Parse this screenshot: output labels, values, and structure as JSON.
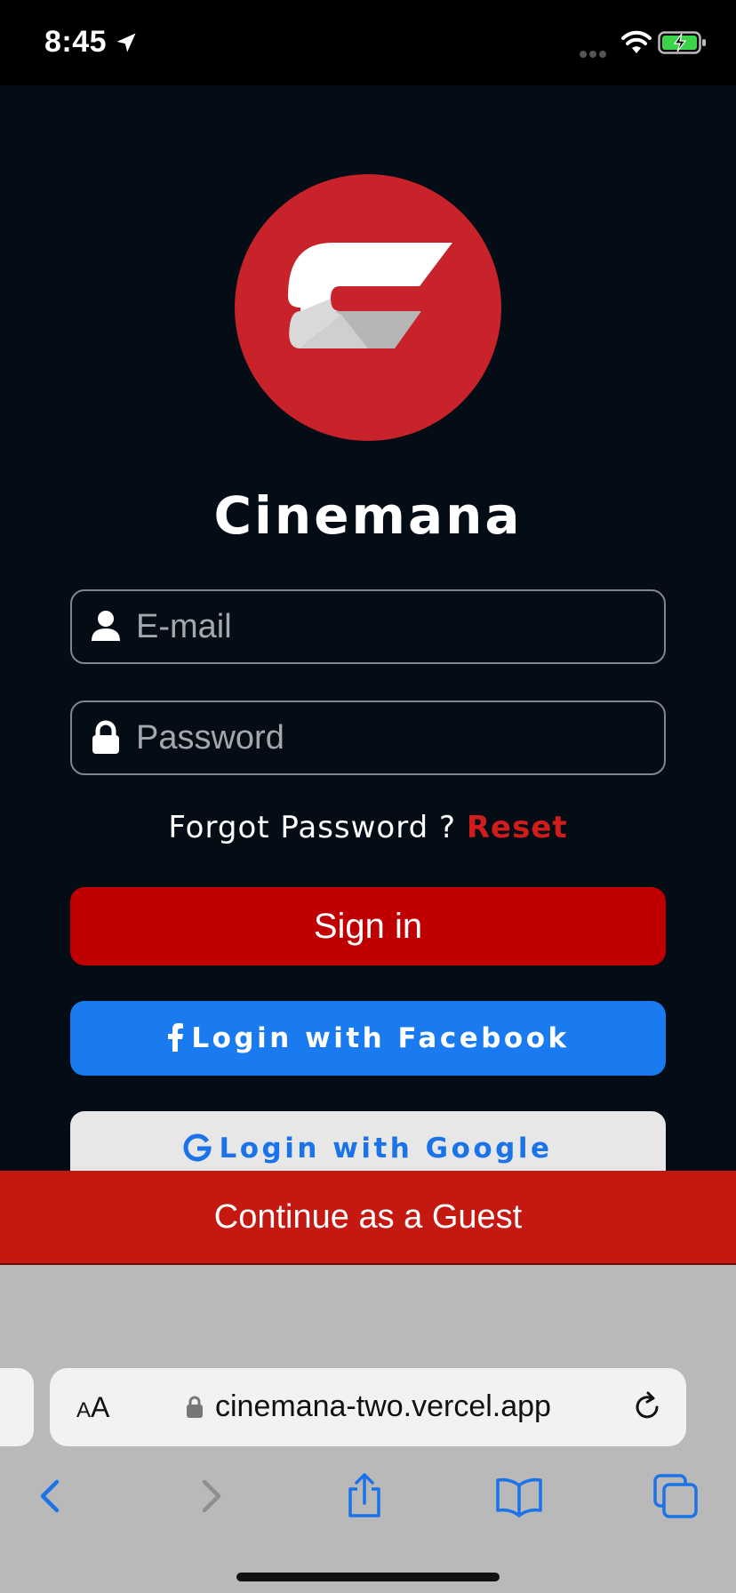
{
  "status_bar": {
    "time": "8:45",
    "icons": [
      "location-arrow-icon",
      "cellular-dots-icon",
      "wifi-icon",
      "battery-charging-icon"
    ]
  },
  "app": {
    "brand_name": "Cinemana",
    "logo_icon": "cinemana-c-logo",
    "email": {
      "placeholder": "E-mail",
      "value": "",
      "icon": "user-icon"
    },
    "password": {
      "placeholder": "Password",
      "value": "",
      "icon": "lock-icon"
    },
    "forgot": {
      "prompt": "Forgot Password ?",
      "reset_label": "Reset"
    },
    "signin_label": "Sign in",
    "facebook_label": "Login with Facebook",
    "google_label": "Login with Google",
    "guest_label": "Continue as a Guest",
    "colors": {
      "background": "#040d15",
      "accent_red": "#c00000",
      "facebook_blue": "#1a7af0",
      "google_blue": "#1a73e8",
      "guest_red": "#c41810"
    }
  },
  "browser": {
    "text_size_label_small": "A",
    "text_size_label_big": "A",
    "url": "cinemana-two.vercel.app",
    "toolbar_icons": [
      "back-icon",
      "forward-icon",
      "share-icon",
      "bookmarks-icon",
      "tabs-icon"
    ]
  }
}
